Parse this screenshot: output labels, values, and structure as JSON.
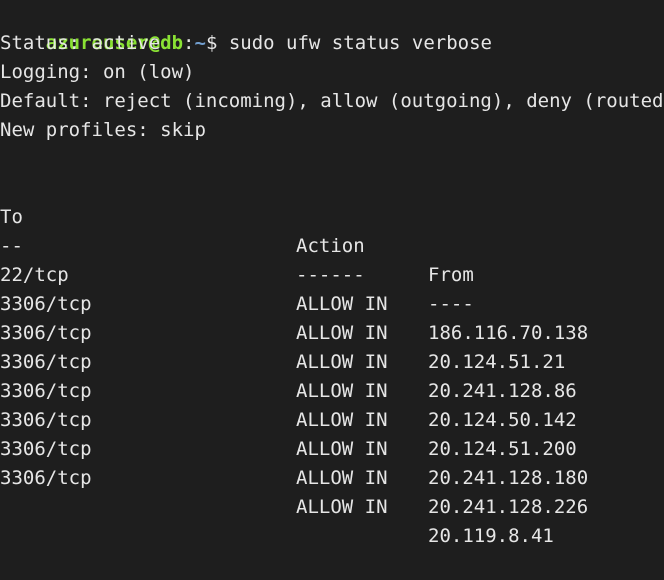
{
  "terminal": {
    "prompt": {
      "user_host": "azureuser@db",
      "separator": ":",
      "path": "~",
      "symbol": "$",
      "command": "sudo ufw status verbose"
    },
    "status_lines": [
      "Status: active",
      "Logging: on (low)",
      "Default: reject (incoming), allow (outgoing), deny (routed)",
      "New profiles: skip"
    ],
    "table": {
      "headers": {
        "to": "To",
        "action": "Action",
        "from": "From"
      },
      "underlines": {
        "to": "--",
        "action": "------",
        "from": "----"
      },
      "rows": [
        {
          "to": "22/tcp",
          "action": "ALLOW IN",
          "from": "186.116.70.138"
        },
        {
          "to": "3306/tcp",
          "action": "ALLOW IN",
          "from": "20.124.51.21"
        },
        {
          "to": "3306/tcp",
          "action": "ALLOW IN",
          "from": "20.241.128.86"
        },
        {
          "to": "3306/tcp",
          "action": "ALLOW IN",
          "from": "20.124.50.142"
        },
        {
          "to": "3306/tcp",
          "action": "ALLOW IN",
          "from": "20.124.51.200"
        },
        {
          "to": "3306/tcp",
          "action": "ALLOW IN",
          "from": "20.241.128.180"
        },
        {
          "to": "3306/tcp",
          "action": "ALLOW IN",
          "from": "20.241.128.226"
        },
        {
          "to": "3306/tcp",
          "action": "ALLOW IN",
          "from": "20.119.8.41"
        }
      ]
    },
    "colors": {
      "background": "#1e1e1e",
      "text": "#e6e6e6",
      "prompt_user": "#8ae234",
      "prompt_path": "#729fcf"
    }
  }
}
